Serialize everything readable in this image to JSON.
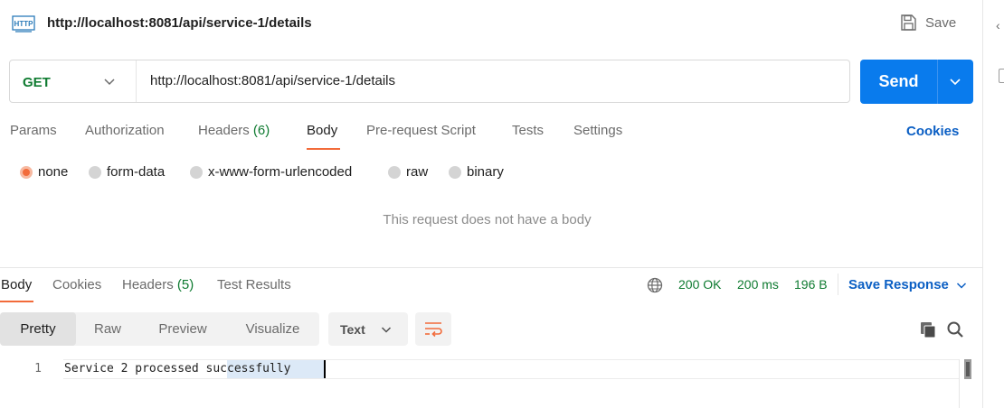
{
  "header": {
    "title": "http://localhost:8081/api/service-1/details",
    "save_label": "Save",
    "http_icon_text": "HTTP"
  },
  "request": {
    "method": "GET",
    "url": "http://localhost:8081/api/service-1/details",
    "send_label": "Send"
  },
  "request_tabs": {
    "params": "Params",
    "authorization": "Authorization",
    "headers": "Headers",
    "headers_count": "(6)",
    "body": "Body",
    "prerequest": "Pre-request Script",
    "tests": "Tests",
    "settings": "Settings",
    "active": "Body",
    "cookies": "Cookies"
  },
  "body_types": {
    "none": "none",
    "form_data": "form-data",
    "urlencoded": "x-www-form-urlencoded",
    "raw": "raw",
    "binary": "binary",
    "selected": "none",
    "empty_message": "This request does not have a body"
  },
  "response": {
    "tabs": {
      "body": "Body",
      "cookies": "Cookies",
      "headers": "Headers",
      "headers_count": "(5)",
      "test_results": "Test Results",
      "active": "Body"
    },
    "status": "200 OK",
    "time": "200 ms",
    "size": "196 B",
    "save_response": "Save Response",
    "format_tabs": {
      "pretty": "Pretty",
      "raw": "Raw",
      "preview": "Preview",
      "visualize": "Visualize",
      "active": "Pretty"
    },
    "language": "Text",
    "lines": [
      {
        "number": "1",
        "text": "Service 2 processed successfully"
      }
    ]
  },
  "colors": {
    "accent": "#f26b3a",
    "send": "#097bed",
    "link": "#0b5fc4",
    "success": "#0f7b31"
  },
  "icons": [
    "http-icon",
    "save-icon",
    "chevron-down-icon",
    "globe-icon",
    "wrap-lines-icon",
    "copy-icon",
    "search-icon"
  ]
}
